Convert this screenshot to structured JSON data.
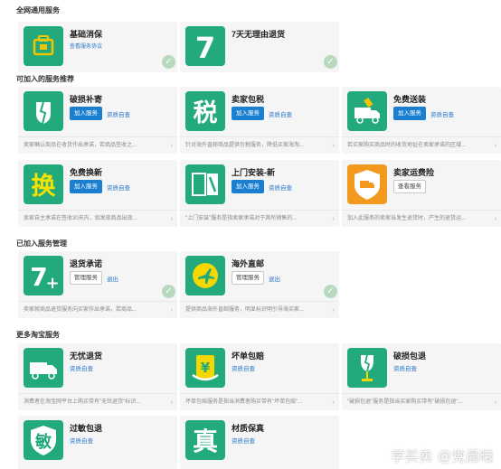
{
  "sections": {
    "general": "全网通用服务",
    "recommend": "可加入的服务推荐",
    "joined": "已加入服务管理",
    "more": "更多淘宝服务"
  },
  "general": [
    {
      "title": "基础消保",
      "link": "查看服务协议",
      "icon": "shield-briefcase-icon",
      "checked": true
    },
    {
      "title": "7天无理由退货",
      "icon": "seven-days-icon",
      "checked": true
    }
  ],
  "recommend": [
    {
      "title": "破损补寄",
      "btn": "加入服务",
      "link": "资质自查",
      "desc": "卖家确认商品在收货作出承诺，若商品签收之...",
      "icon": "broken-shield-icon"
    },
    {
      "title": "卖家包税",
      "btn": "加入服务",
      "link": "资质自查",
      "desc": "针对海外直邮商品提供包税服务，降低买家海淘...",
      "icon": "tax-icon"
    },
    {
      "title": "免费送装",
      "btn": "加入服务",
      "link": "资质自查",
      "desc": "若买家购买商品时的收货地址在卖家承诺的区域...",
      "icon": "delivery-truck-icon"
    },
    {
      "title": "免费换新",
      "btn": "加入服务",
      "link": "资质自查",
      "desc": "卖家自主承诺在签收30天内，如发现商品出现...",
      "icon": "exchange-icon"
    },
    {
      "title": "上门安装-新",
      "btn": "加入服务",
      "link": "资质自查",
      "desc": "\"上门安装\"服务是指卖家承诺对于其所销售的...",
      "icon": "install-door-icon"
    },
    {
      "title": "卖家运费险",
      "btn": "查看服务",
      "desc": "加入此服务的卖家当发生退货时，产生的退货运...",
      "icon": "freight-insurance-icon"
    }
  ],
  "joined": [
    {
      "title": "退货承诺",
      "btn": "管理服务",
      "link": "退出",
      "desc": "卖家就商品退货服务向买家作出承诺，若商品...",
      "icon": "return-promise-icon",
      "checked": true
    },
    {
      "title": "海外直邮",
      "btn": "管理服务",
      "link": "退出",
      "desc": "提供商品海外直邮服务，明显标识明引导海买家...",
      "icon": "overseas-plane-icon",
      "checked": true
    }
  ],
  "more": [
    {
      "title": "无忧退货",
      "link": "资质自查",
      "desc": "消费者在淘宝网平台上购买带有\"无忧退货\"标识...",
      "icon": "worry-free-truck-icon"
    },
    {
      "title": "坏单包赔",
      "link": "资质自查",
      "desc": "坏单包赔服务是指当消费者购买带有\"坏单包赔\"...",
      "icon": "bad-order-compensation-icon"
    },
    {
      "title": "破损包退",
      "link": "资质自查",
      "desc": "\"破损包退\"服务是指当买家购买带有\"破损包退\"...",
      "icon": "broken-return-icon"
    },
    {
      "title": "过敏包退",
      "link": "资质自查",
      "icon": "allergy-return-icon"
    },
    {
      "title": "材质保真",
      "link": "资质自查",
      "icon": "material-authentic-icon"
    }
  ],
  "colors": {
    "green": "#22a97c",
    "blue": "#1a7fd0",
    "orange": "#f39a1e"
  },
  "watermark": "学买卖 @党晨曦"
}
